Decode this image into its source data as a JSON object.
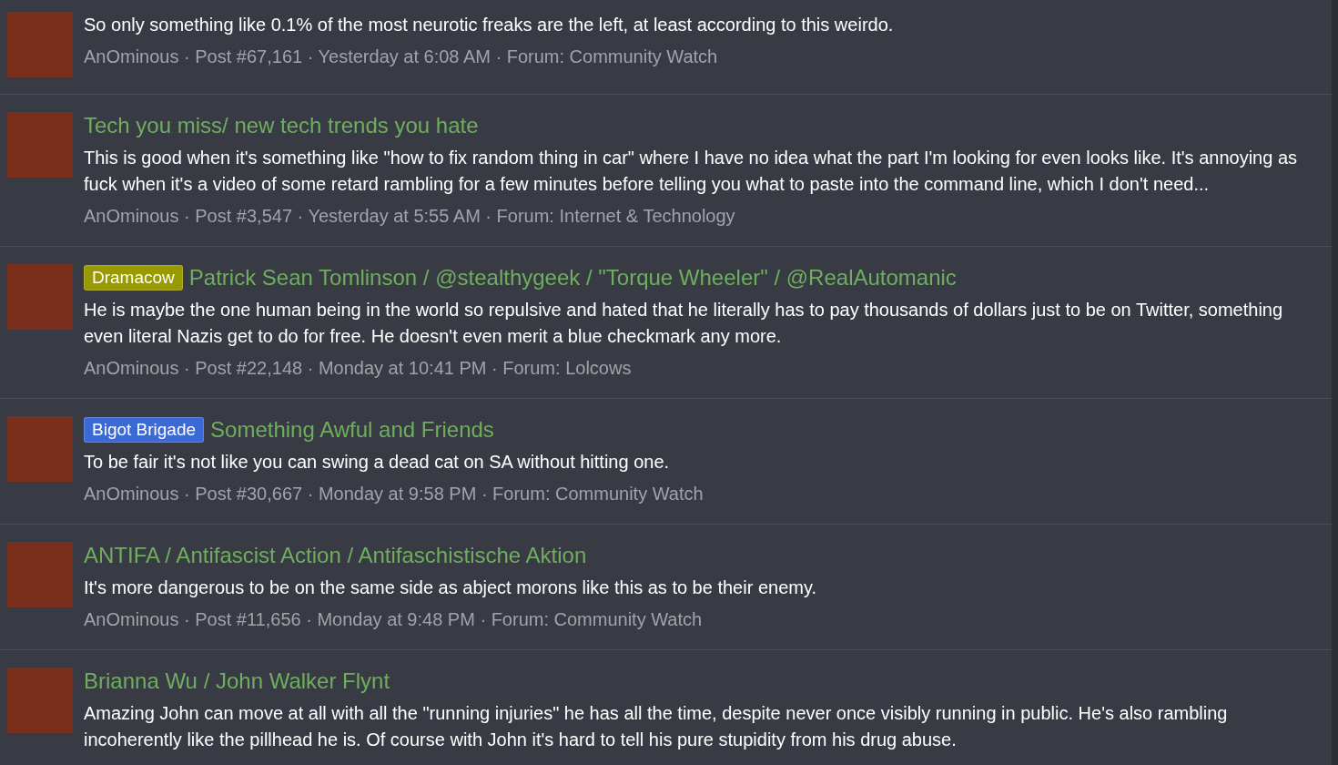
{
  "results": [
    {
      "body": "So only something like 0.1% of the most neurotic freaks are the left, at least according to this weirdo.",
      "meta": "AnOminous · Post #67,161 · Yesterday at 6:08 AM · Forum: Community Watch"
    },
    {
      "title": "Tech you miss/ new tech trends you hate",
      "body": "This is good when it's something like \"how to fix random thing in car\" where I have no idea what the part I'm looking for even looks like. It's annoying as fuck when it's a video of some retard rambling for a few minutes before telling you what to paste into the command line, which I don't need...",
      "meta": "AnOminous · Post #3,547 · Yesterday at 5:55 AM · Forum: Internet & Technology"
    },
    {
      "prefix": {
        "label": "Dramacow",
        "color": "#999900"
      },
      "title": "Patrick Sean Tomlinson / @stealthygeek / \"Torque Wheeler\" / @RealAutomanic",
      "body": "He is maybe the one human being in the world so repulsive and hated that he literally has to pay thousands of dollars just to be on Twitter, something even literal Nazis get to do for free. He doesn't even merit a blue checkmark any more.",
      "meta": "AnOminous · Post #22,148 · Monday at 10:41 PM · Forum: Lolcows"
    },
    {
      "prefix": {
        "label": "Bigot Brigade",
        "color": "#3b6ad6"
      },
      "title": "Something Awful and Friends",
      "body": "To be fair it's not like you can swing a dead cat on SA without hitting one.",
      "meta": "AnOminous · Post #30,667 · Monday at 9:58 PM · Forum: Community Watch"
    },
    {
      "title": "ANTIFA / Antifascist Action / Antifaschistische Aktion",
      "body": "It's more dangerous to be on the same side as abject morons like this as to be their enemy.",
      "meta": "AnOminous · Post #11,656 · Monday at 9:48 PM · Forum: Community Watch"
    },
    {
      "title": "Brianna Wu / John Walker Flynt",
      "body": "Amazing John can move at all with all the \"running injuries\" he has all the time, despite never once visibly running in public. He's also rambling incoherently like the pillhead he is. Of course with John it's hard to tell his pure stupidity from his drug abuse."
    }
  ]
}
